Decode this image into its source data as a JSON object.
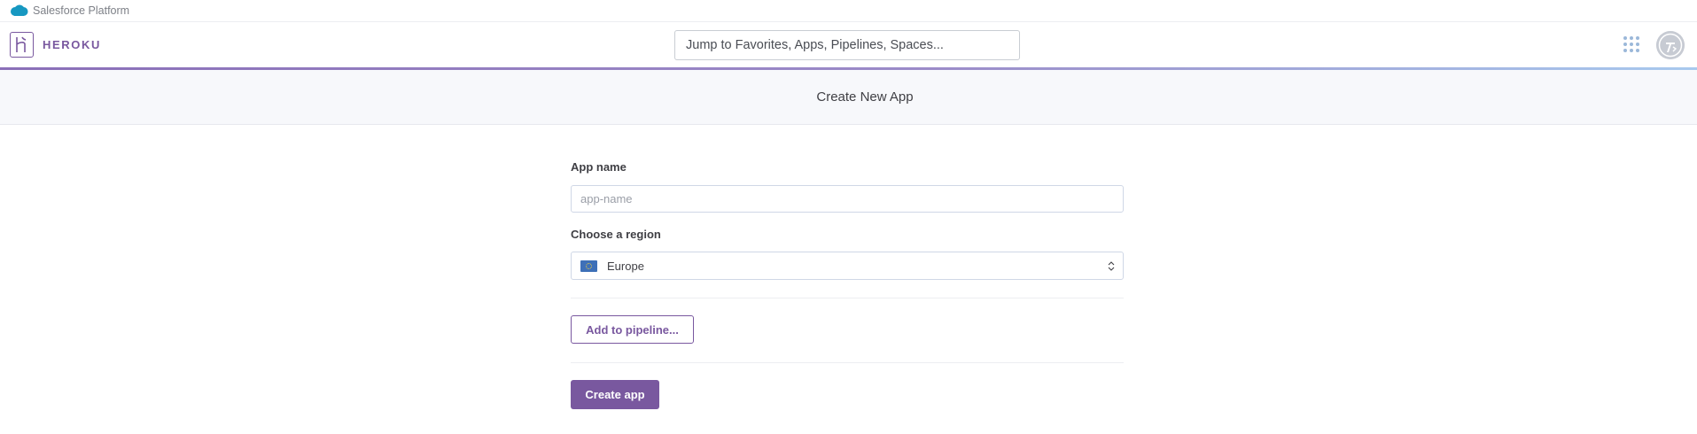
{
  "platform_bar": {
    "label": "Salesforce Platform",
    "icon": "salesforce-cloud-icon"
  },
  "header": {
    "brand": "HEROKU",
    "logo_icon": "heroku-logo-icon",
    "search_placeholder": "Jump to Favorites, Apps, Pipelines, Spaces...",
    "apps_icon": "apps-grid-icon",
    "avatar_icon": "user-avatar-icon"
  },
  "page": {
    "title": "Create New App"
  },
  "form": {
    "app_name_label": "App name",
    "app_name_placeholder": "app-name",
    "app_name_value": "",
    "region_label": "Choose a region",
    "region_value": "Europe",
    "region_flag_icon": "eu-flag-icon",
    "add_pipeline_label": "Add to pipeline...",
    "create_label": "Create app"
  },
  "colors": {
    "brand_purple": "#79589f",
    "subheader_bg": "#f7f8fb",
    "search_border": "#c9cdd3"
  }
}
